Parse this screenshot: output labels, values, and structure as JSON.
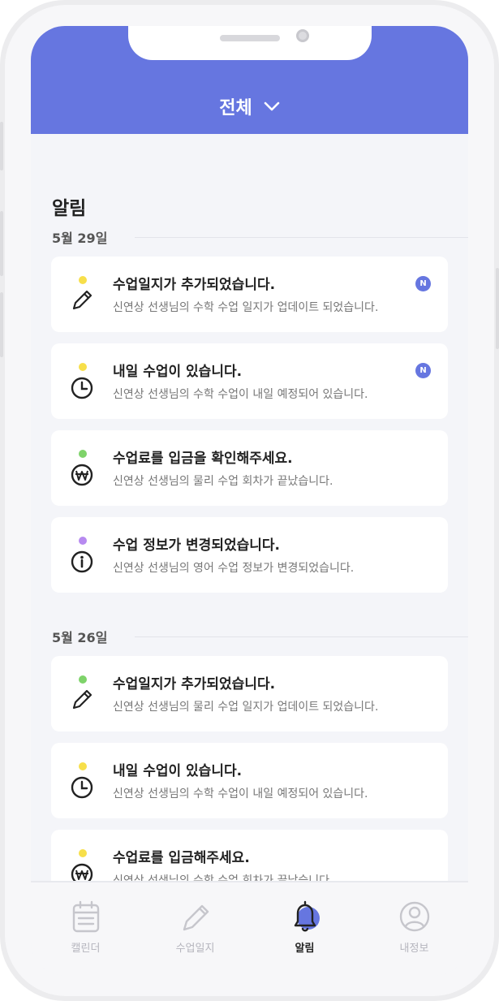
{
  "header": {
    "title": "전체"
  },
  "page_title": "알림",
  "groups": [
    {
      "date": "5월 29일",
      "items": [
        {
          "dot": "#f7df4a",
          "icon": "pencil-icon",
          "title": "수업일지가 추가되었습니다.",
          "subtitle": "신연상 선생님의 수학 수업 일지가 업데이트 되었습니다.",
          "badge": "N"
        },
        {
          "dot": "#f7df4a",
          "icon": "clock-icon",
          "title": "내일 수업이 있습니다.",
          "subtitle": "신연상 선생님의 수학 수업이 내일 예정되어 있습니다.",
          "badge": "N"
        },
        {
          "dot": "#7ed36a",
          "icon": "won-icon",
          "title": "수업료를 입금을 확인해주세요.",
          "subtitle": "신연상 선생님의 물리 수업 회차가 끝났습니다."
        },
        {
          "dot": "#b78af0",
          "icon": "info-icon",
          "title": "수업 정보가 변경되었습니다.",
          "subtitle": "신연상 선생님의 영어 수업 정보가 변경되었습니다."
        }
      ]
    },
    {
      "date": "5월 26일",
      "items": [
        {
          "dot": "#7ed36a",
          "icon": "pencil-icon",
          "title": "수업일지가 추가되었습니다.",
          "subtitle": "신연상 선생님의 물리 수업 일지가 업데이트 되었습니다."
        },
        {
          "dot": "#f7df4a",
          "icon": "clock-icon",
          "title": "내일 수업이 있습니다.",
          "subtitle": "신연상 선생님의 수학 수업이 내일 예정되어 있습니다."
        },
        {
          "dot": "#f7df4a",
          "icon": "won-icon",
          "title": "수업료를 입금해주세요.",
          "subtitle": "신연상 선생님의 수학 수업 회차가 끝났습니다."
        }
      ]
    }
  ],
  "tabs": [
    {
      "label": "캘린더",
      "icon": "calendar-icon"
    },
    {
      "label": "수업일지",
      "icon": "pencil-icon"
    },
    {
      "label": "알림",
      "icon": "bell-icon",
      "active": true
    },
    {
      "label": "내정보",
      "icon": "user-icon"
    }
  ],
  "colors": {
    "accent": "#6676e0",
    "background": "#f4f5f9",
    "card": "#ffffff"
  }
}
